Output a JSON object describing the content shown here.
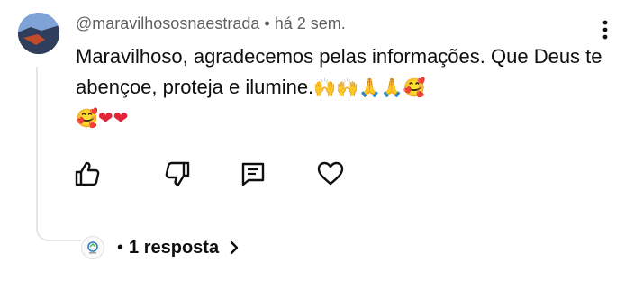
{
  "comment": {
    "author": "@maravilhososnaestrada",
    "separator": " • ",
    "time": "há 2 sem.",
    "text": "Maravilhoso, agradecemos pelas informações. Que Deus te abençoe, proteja e ilumine.",
    "emojis": [
      "raising-hands",
      "raising-hands",
      "folded-hands",
      "folded-hands",
      "smiling-face-with-hearts",
      "smiling-face-with-hearts",
      "red-heart",
      "red-heart"
    ]
  },
  "actions": {
    "like_icon": "thumbs-up-icon",
    "dislike_icon": "thumbs-down-icon",
    "reply_icon": "comment-icon",
    "heart_icon": "heart-icon"
  },
  "replies": {
    "dot": "•",
    "label": "1 resposta"
  },
  "colors": {
    "meta": "#606060",
    "text": "#0f0f0f",
    "thread_line": "#e5e5e5",
    "heart": "#e0253a",
    "hands": "#f2b705"
  }
}
